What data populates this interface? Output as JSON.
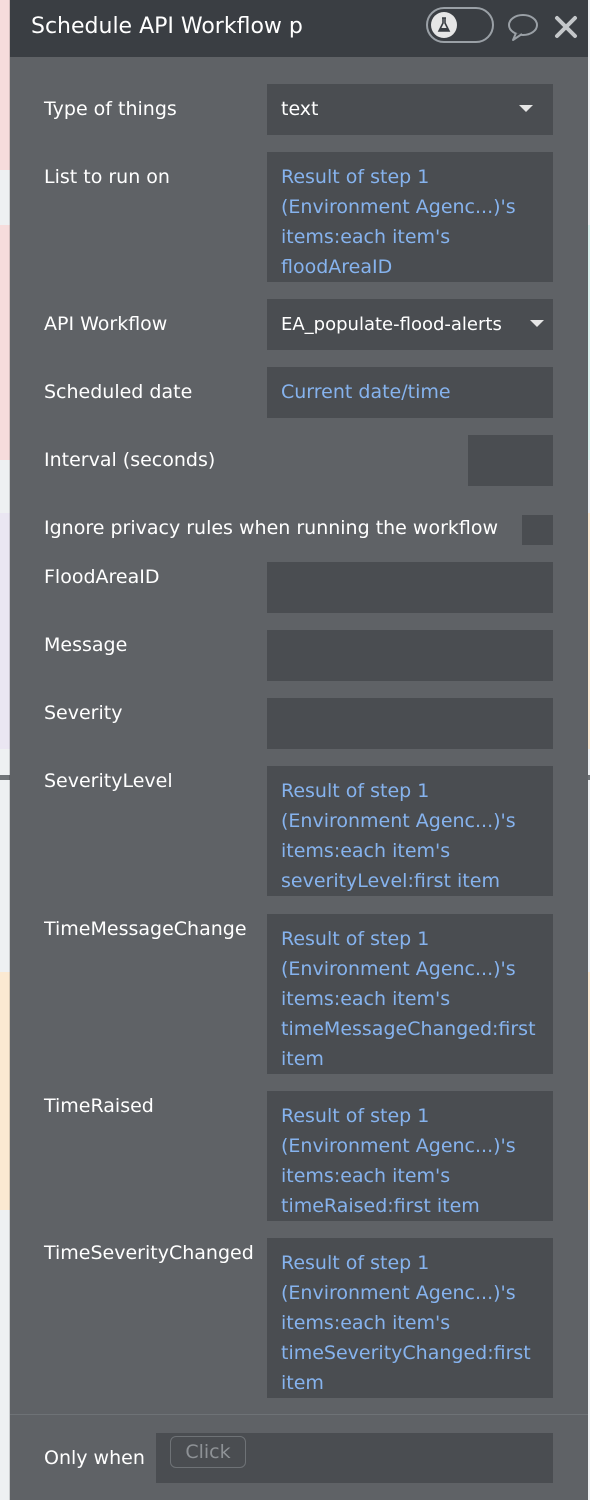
{
  "panel": {
    "title": "Schedule API Workflow p",
    "icons": [
      "flask-icon",
      "comment-icon",
      "close-icon"
    ]
  },
  "rows": {
    "type_of_things": {
      "label": "Type of things",
      "value": "text"
    },
    "list_to_run_on": {
      "label": "List to run on",
      "value": "Result of step 1 (Environment Agenc...)'s items:each item's floodAreaID"
    },
    "api_workflow": {
      "label": "API Workflow",
      "value": "EA_populate-flood-alerts"
    },
    "scheduled_date": {
      "label": "Scheduled date",
      "value": "Current date/time"
    },
    "interval": {
      "label": "Interval (seconds)",
      "value": ""
    },
    "ignore_privacy": {
      "label": "Ignore privacy rules when running the workflow",
      "checked": false
    },
    "flood_area_id": {
      "label": "FloodAreaID",
      "value": ""
    },
    "message": {
      "label": "Message",
      "value": ""
    },
    "severity": {
      "label": "Severity",
      "value": ""
    },
    "severity_level": {
      "label": "SeverityLevel",
      "value": "Result of step 1 (Environment Agenc...)'s items:each item's severityLevel:first item"
    },
    "time_message_changed": {
      "label": "TimeMessageChange",
      "value": "Result of step 1 (Environment Agenc...)'s items:each item's timeMessageChanged:first item"
    },
    "time_raised": {
      "label": "TimeRaised",
      "value": "Result of step 1 (Environment Agenc...)'s items:each item's timeRaised:first item"
    },
    "time_severity_changed": {
      "label": "TimeSeverityChanged",
      "value": "Result of step 1 (Environment Agenc...)'s items:each item's timeSeverityChanged:first item"
    }
  },
  "footer": {
    "label": "Only when",
    "placeholder": "Click"
  },
  "colors": {
    "panel_bg": "#5f6266",
    "titlebar_bg": "#3a3e43",
    "field_bg": "#4a4d51",
    "expression_text": "#86b3ee"
  }
}
